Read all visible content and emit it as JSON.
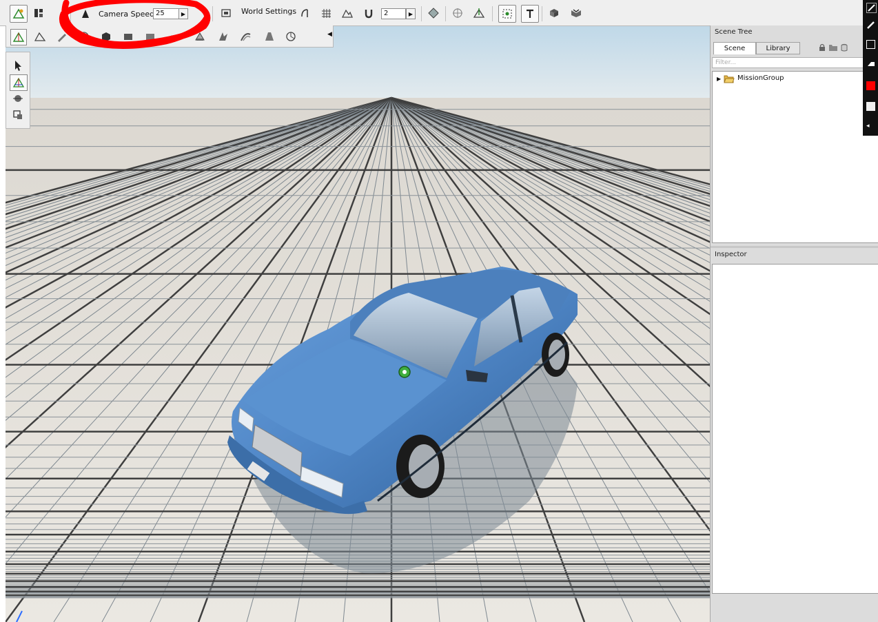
{
  "toolbar": {
    "camera_speed_label": "Camera Speed",
    "camera_speed_value": "25",
    "world_settings_label": "World Settings",
    "snap_value": "2"
  },
  "scene_tree": {
    "title": "Scene Tree",
    "tabs": [
      {
        "label": "Scene"
      },
      {
        "label": "Library"
      }
    ],
    "filter_placeholder": "Filter...",
    "items": [
      {
        "label": "MissionGroup"
      }
    ]
  },
  "inspector": {
    "title": "Inspector"
  },
  "colors": {
    "toolbar_bg": "#efefef",
    "car_blue": "#4f86c6",
    "annotation_red": "#ff0000",
    "grid_line": "#4a4a4a"
  }
}
